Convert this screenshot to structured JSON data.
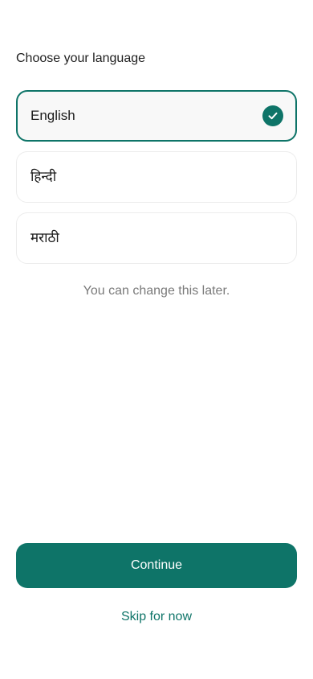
{
  "header": {
    "title": "Choose your language"
  },
  "languages": [
    {
      "label": "English",
      "selected": true
    },
    {
      "label": "हिन्दी",
      "selected": false
    },
    {
      "label": "मराठी",
      "selected": false
    }
  ],
  "hint": "You can change this later.",
  "actions": {
    "continue_label": "Continue",
    "skip_label": "Skip for now"
  },
  "colors": {
    "accent": "#0e7468",
    "hint_text": "#7a7a7a",
    "option_border": "#ececec",
    "selected_background": "#f8f8f8"
  },
  "icons": {
    "selected_indicator": "check-circle-icon"
  }
}
